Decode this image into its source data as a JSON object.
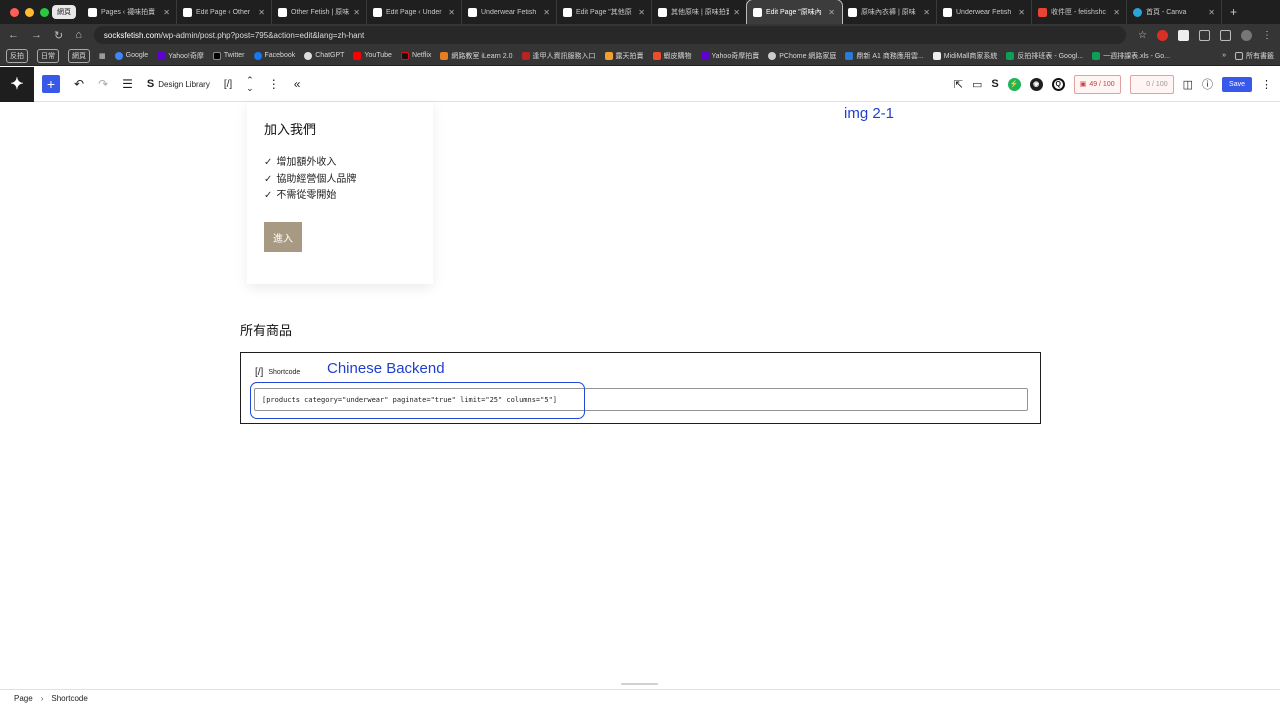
{
  "browser": {
    "group_chip": "網頁",
    "tabs": [
      {
        "title": "Pages ‹ 襪味拍賣"
      },
      {
        "title": "Edit Page ‹ Other"
      },
      {
        "title": "Other Fetish | 原味"
      },
      {
        "title": "Edit Page ‹ Under"
      },
      {
        "title": "Underwear Fetish"
      },
      {
        "title": "Edit Page \"其他原"
      },
      {
        "title": "其他原味 | 原味拍賣"
      },
      {
        "title": "Edit Page \"原味內"
      },
      {
        "title": "原味內衣褲 | 原味"
      },
      {
        "title": "Underwear Fetish"
      },
      {
        "title": "收件匣 - fetishshc"
      },
      {
        "title": "首頁 - Canva"
      }
    ],
    "new_tab": "+",
    "url_host": "socksfetish.com",
    "url_path": "/wp-admin/post.php?post=795&action=edit&lang=zh-hant",
    "bookmark_chips": [
      "反拍",
      "日常",
      "網頁"
    ],
    "bookmarks": [
      "Google",
      "Yahoo!奇摩",
      "Twitter",
      "Facebook",
      "ChatGPT",
      "YouTube",
      "Netflix",
      "網路教室 iLearn 2.0",
      "逢甲人資訊服務入口",
      "露天拍賣",
      "蝦皮購物",
      "Yahoo奇摩拍賣",
      "PChome 網路家庭",
      "鼎新 A1 商務應用雲...",
      "MidiMall商家系統",
      "反拍排班表 - Googl...",
      "一週排課表.xls - Go..."
    ],
    "bookmarks_more": "»",
    "all_bookmarks": "所有書籤"
  },
  "toolbar": {
    "design_library": "Design Library",
    "shortcode_glyph": "[/]",
    "score_label": "49 / 100",
    "score2_label": "0 / 100",
    "save_label": "Save"
  },
  "content": {
    "card_title": "加入我們",
    "card_items": [
      "增加額外收入",
      "協助經營個人品牌",
      "不需從零開始"
    ],
    "card_button": "進入",
    "annotation_img": "img 2-1",
    "section_title": "所有商品",
    "shortcode_label": "Shortcode",
    "shortcode_glyph": "[/]",
    "annotation_backend": "Chinese Backend",
    "shortcode_value": "[products category=\"underwear\" paginate=\"true\" limit=\"25\" columns=\"5\"]"
  },
  "footer": {
    "crumbs": [
      "Page",
      "Shortcode"
    ]
  },
  "colors": {
    "wp_blue": "#3858e9",
    "annotation_blue": "#1f3fd0",
    "button_tan": "#a89a82"
  }
}
